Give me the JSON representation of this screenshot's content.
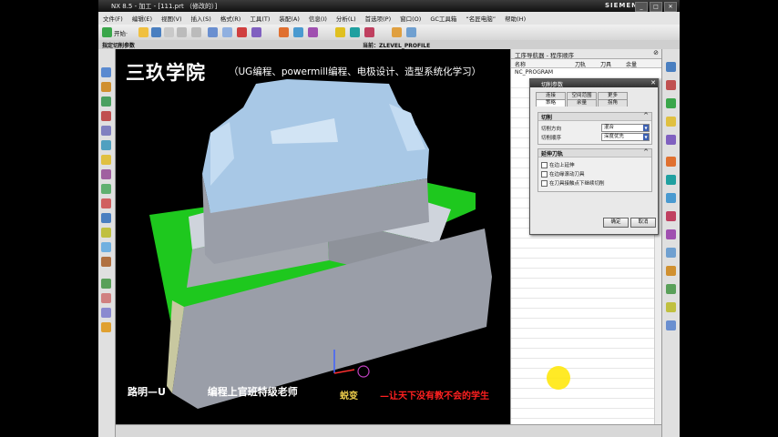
{
  "window": {
    "title": "NX 8.5 - 加工 - [111.prt （修改的）]",
    "brand": "SIEMENS"
  },
  "menu": [
    "文件(F)",
    "编辑(E)",
    "视图(V)",
    "插入(S)",
    "格式(R)",
    "工具(T)",
    "装配(A)",
    "信息(I)",
    "分析(L)",
    "首选项(P)",
    "窗口(O)",
    "GC工具箱",
    "“名匠电脑”",
    "帮助(H)"
  ],
  "toolbar": {
    "start_label": "开始·"
  },
  "status": {
    "left": "指定切削参数",
    "current": "当前：ZLEVEL_PROFILE"
  },
  "watermark": {
    "title": "三玖学院",
    "subtitle": "（UG编程、powermill编程、电极设计、造型系统化学习）",
    "bottom_left": "路明—U",
    "bottom_left2": "编程上官班特级老师",
    "bottom_right_name": "蜕变",
    "bottom_right_slogan": "—让天下没有教不会的学生"
  },
  "navigator": {
    "title": "工序导航器 - 程序顺序",
    "columns": [
      "名称",
      "刀轨",
      "刀具",
      "余量"
    ],
    "root": "NC_PROGRAM"
  },
  "dialog": {
    "title": "切削参数",
    "tabs_row1": [
      "连接",
      "空间范围",
      "更多"
    ],
    "tabs_row2": [
      "策略",
      "余量",
      "拐角"
    ],
    "group1": {
      "title": "切削",
      "fields": [
        {
          "label": "切削方向",
          "value": "混合"
        },
        {
          "label": "切削顺序",
          "value": "深度优先"
        }
      ]
    },
    "group2": {
      "title": "延伸刀轨",
      "checkboxes": [
        "在边上延伸",
        "在边缘滚动刀具",
        "在刀具接触点下继续切削"
      ]
    },
    "ok": "确定",
    "cancel": "取消"
  },
  "colors": {
    "part_face": "#a8c8e6",
    "part_side": "#9a9ea8",
    "floor": "#1ec81e",
    "accent": "#3b5fb0"
  }
}
